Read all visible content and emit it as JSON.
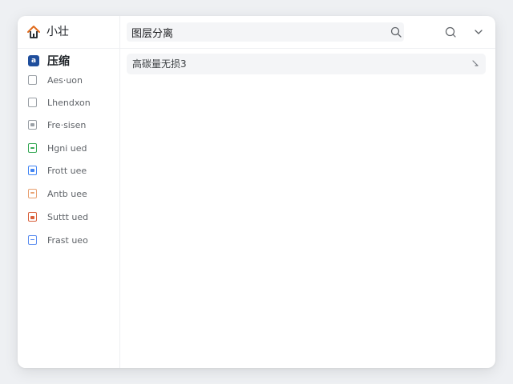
{
  "sidebar": {
    "title": "小壮",
    "section": {
      "label": "压缩",
      "icon": "a",
      "icon_color": "#1f4e9c"
    },
    "items": [
      {
        "label": "Aes·uon",
        "icon": "document-icon",
        "accent": ""
      },
      {
        "label": "Lhendxon",
        "icon": "document-icon",
        "accent": ""
      },
      {
        "label": "Fre·sisen",
        "icon": "document-icon",
        "accent": "#9aa0a6"
      },
      {
        "label": "Hgni ued",
        "icon": "document-icon",
        "accent": "#34a853"
      },
      {
        "label": "Frott uee",
        "icon": "document-icon",
        "accent": "#4285f4"
      },
      {
        "label": "Antb uee",
        "icon": "document-icon",
        "accent": "#e8a070"
      },
      {
        "label": "Suttt ued",
        "icon": "document-icon",
        "accent": "#d9603b"
      },
      {
        "label": "Frast ueo",
        "icon": "document-icon",
        "accent": "#5b8def"
      }
    ]
  },
  "toolbar": {
    "search_value": "图层分离",
    "search_placeholder": "图层分离"
  },
  "results": [
    {
      "label": "高碳量无损3"
    }
  ],
  "colors": {
    "home_icon_stroke": "#e06a1b",
    "home_icon_fill": "#1f2328"
  }
}
